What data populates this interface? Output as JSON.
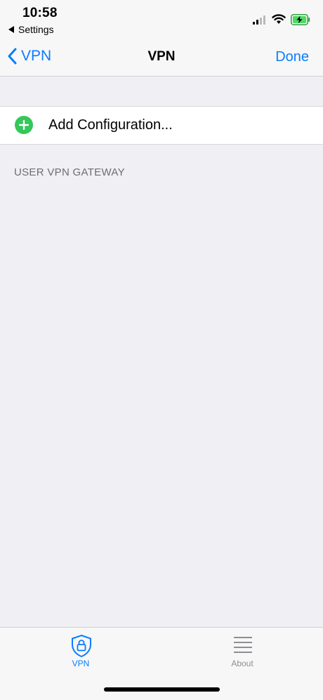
{
  "status_bar": {
    "time": "10:58",
    "back_label": "Settings"
  },
  "nav": {
    "back_label": "VPN",
    "title": "VPN",
    "done_label": "Done"
  },
  "config": {
    "add_label": "Add Configuration...",
    "add_icon": "plus-circle-icon"
  },
  "section": {
    "header": "USER VPN GATEWAY"
  },
  "tabs": [
    {
      "label": "VPN",
      "icon": "shield-lock-icon",
      "selected": true
    },
    {
      "label": "About",
      "icon": "list-icon",
      "selected": false
    }
  ],
  "colors": {
    "accent": "#0a7cff",
    "add_green": "#34c759",
    "background": "#efeff4"
  }
}
